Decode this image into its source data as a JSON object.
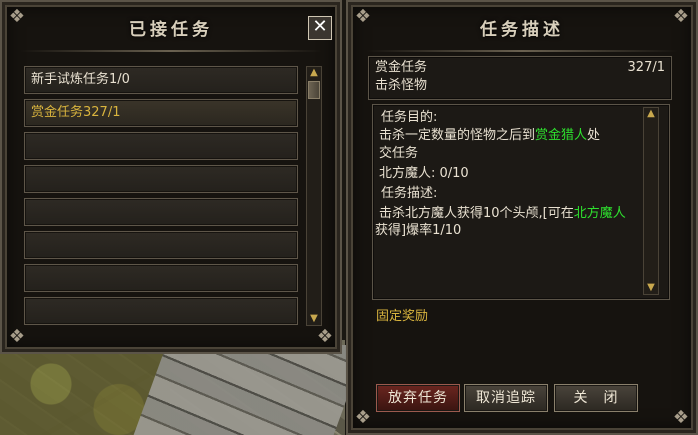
{
  "accepted_panel": {
    "title": "已接任务",
    "close_glyph": "✕",
    "quests": [
      {
        "label": "新手试炼任务1/0",
        "selected": false
      },
      {
        "label": "赏金任务327/1",
        "selected": true
      },
      {
        "label": "",
        "selected": false
      },
      {
        "label": "",
        "selected": false
      },
      {
        "label": "",
        "selected": false
      },
      {
        "label": "",
        "selected": false
      },
      {
        "label": "",
        "selected": false
      },
      {
        "label": "",
        "selected": false
      }
    ]
  },
  "desc_panel": {
    "title": "任务描述",
    "quest_name": "赏金任务",
    "quest_count": "327/1",
    "quest_subtitle": "击杀怪物",
    "body": {
      "goal_label": "任务目的:",
      "goal_line1_pre": "击杀一定数量的怪物之后到",
      "goal_line1_npc": "赏金猎人",
      "goal_line1_post": "处",
      "goal_line2": "交任务",
      "progress": "北方魔人: 0/10",
      "desc_label": "任务描述:",
      "desc_line1_pre": "击杀北方魔人获得10个头颅,[可在",
      "desc_line1_loc": "北方魔人",
      "desc_line2": "获得]爆率1/10"
    },
    "reward_label": "固定奖励",
    "buttons": {
      "abandon": "放弃任务",
      "untrack": "取消追踪",
      "close": "关　闭"
    }
  },
  "colors": {
    "highlight_green": "#2ee02e",
    "selected_gold": "#d9b43e"
  }
}
